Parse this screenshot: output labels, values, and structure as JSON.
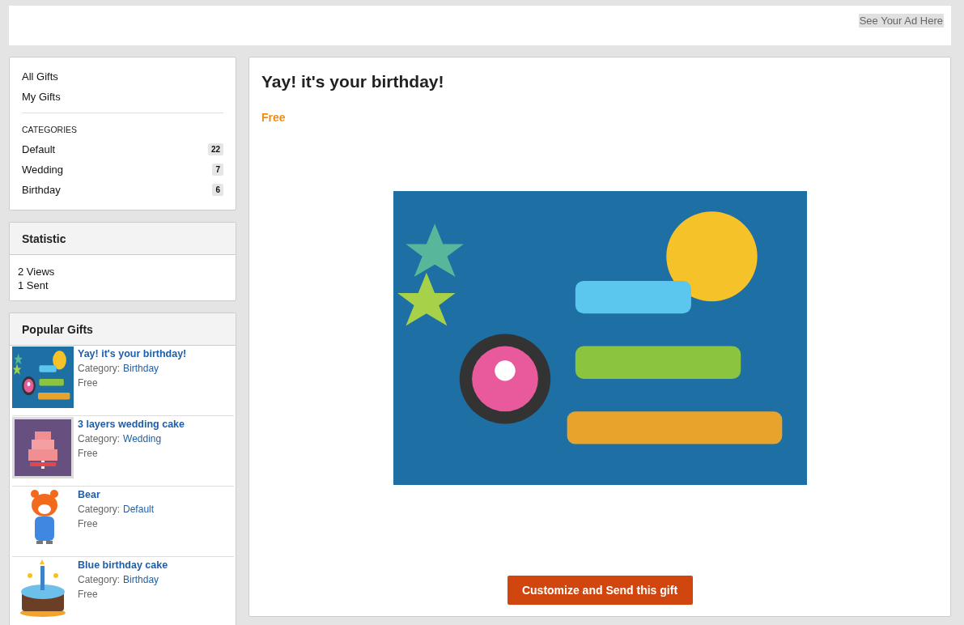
{
  "ad_bar": {
    "link": "See Your Ad Here"
  },
  "sidebar": {
    "nav": [
      {
        "label": "All Gifts"
      },
      {
        "label": "My Gifts"
      }
    ],
    "categories_heading": "CATEGORIES",
    "categories": [
      {
        "label": "Default",
        "count": "22"
      },
      {
        "label": "Wedding",
        "count": "7"
      },
      {
        "label": "Birthday",
        "count": "6"
      }
    ],
    "statistic": {
      "title": "Statistic",
      "lines": [
        "2 Views",
        "1 Sent"
      ]
    },
    "popular": {
      "title": "Popular Gifts",
      "items": [
        {
          "name": "Yay! it's your birthday!",
          "category_label": "Category:",
          "category": "Birthday",
          "price": "Free"
        },
        {
          "name": "3 layers wedding cake",
          "category_label": "Category:",
          "category": "Wedding",
          "price": "Free"
        },
        {
          "name": "Bear",
          "category_label": "Category:",
          "category": "Default",
          "price": "Free"
        },
        {
          "name": "Blue birthday cake",
          "category_label": "Category:",
          "category": "Birthday",
          "price": "Free"
        }
      ]
    }
  },
  "gift": {
    "title": "Yay! it's your birthday!",
    "price": "Free",
    "button": "Customize and Send this gift"
  }
}
